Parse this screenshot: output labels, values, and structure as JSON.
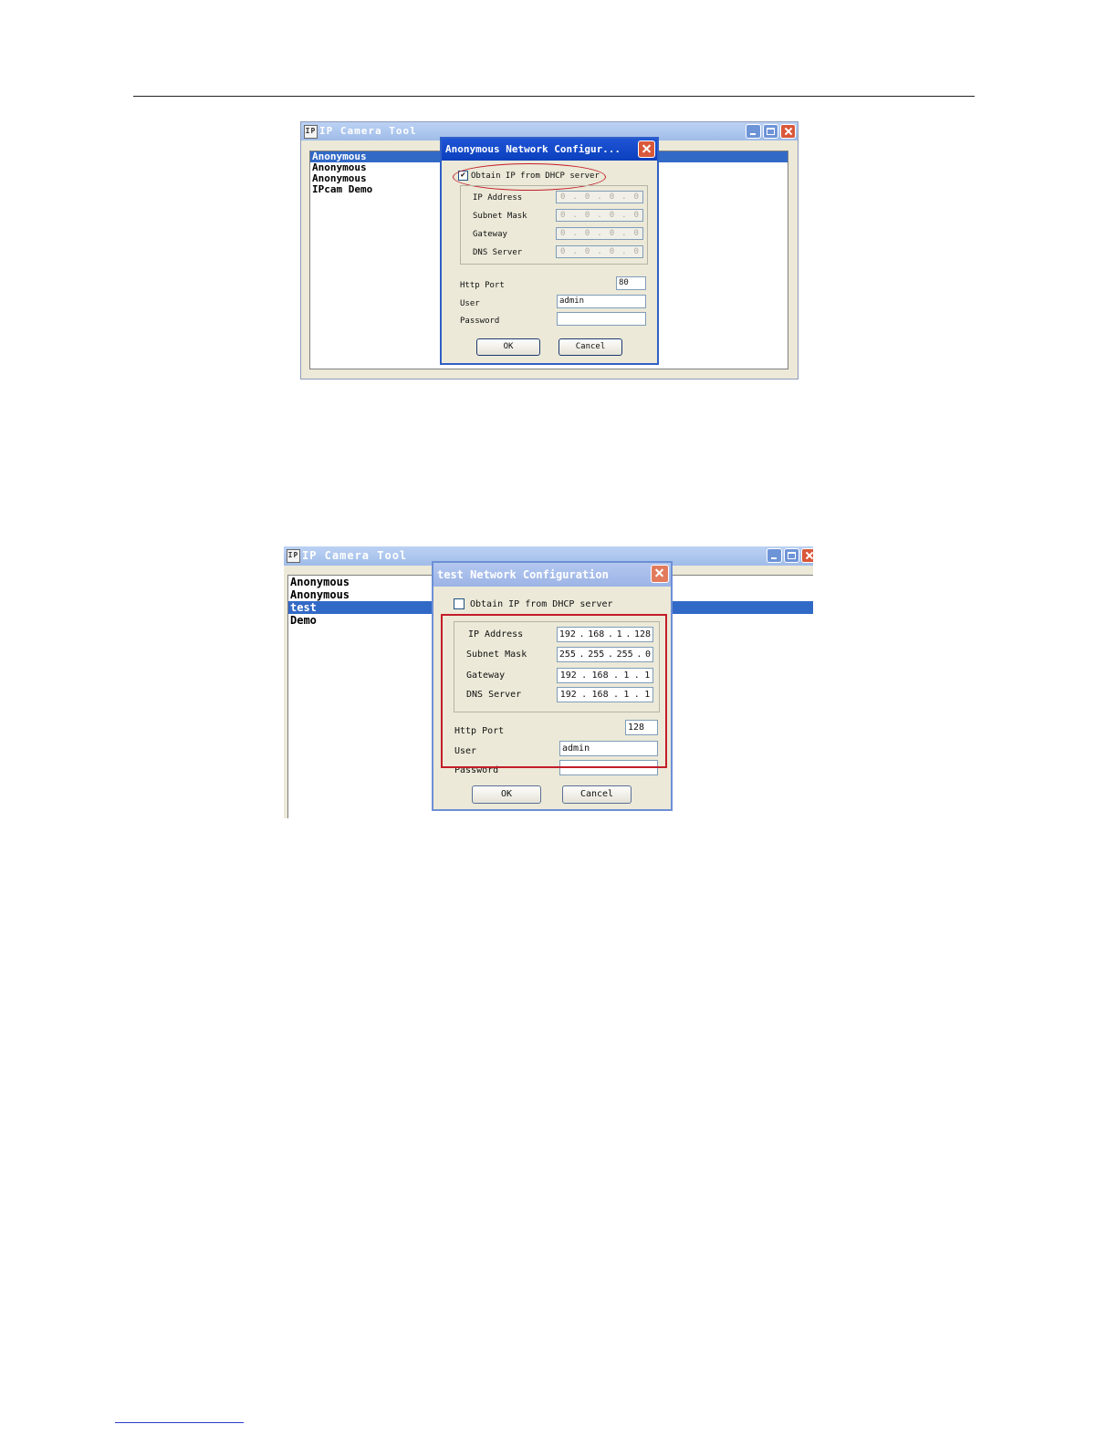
{
  "screenshots": [
    {
      "app": {
        "title": "IP Camera Tool",
        "icon_text": "IP",
        "cameras": [
          {
            "label": "Anonymous",
            "selected": true
          },
          {
            "label": "Anonymous",
            "selected": false
          },
          {
            "label": "Anonymous",
            "selected": false
          },
          {
            "label": "IPcam Demo",
            "selected": false
          }
        ]
      },
      "dialog": {
        "title": "Anonymous Network Configur...",
        "dhcp": {
          "label": "Obtain IP from DHCP server",
          "checked": true,
          "check_mark": "✔"
        },
        "network": [
          {
            "label": "IP Address",
            "octets": [
              "0",
              "0",
              "0",
              "0"
            ]
          },
          {
            "label": "Subnet Mask",
            "octets": [
              "0",
              "0",
              "0",
              "0"
            ]
          },
          {
            "label": "Gateway",
            "octets": [
              "0",
              "0",
              "0",
              "0"
            ]
          },
          {
            "label": "DNS Server",
            "octets": [
              "0",
              "0",
              "0",
              "0"
            ]
          }
        ],
        "http_port": {
          "label": "Http Port",
          "value": "80"
        },
        "user": {
          "label": "User",
          "value": "admin"
        },
        "password": {
          "label": "Password",
          "value": ""
        },
        "ok_label": "OK",
        "cancel_label": "Cancel"
      },
      "highlight": "ellipse around DHCP checkbox"
    },
    {
      "app": {
        "title": "IP Camera Tool",
        "icon_text": "IP",
        "cameras": [
          {
            "label": "Anonymous",
            "selected": false
          },
          {
            "label": "Anonymous",
            "selected": false
          },
          {
            "label": "test",
            "selected": true
          },
          {
            "label": "Demo",
            "selected": false
          }
        ]
      },
      "dialog": {
        "title": "test Network Configuration",
        "dhcp": {
          "label": "Obtain IP from DHCP server",
          "checked": false,
          "check_mark": ""
        },
        "network": [
          {
            "label": "IP Address",
            "octets": [
              "192",
              "168",
              "1",
              "128"
            ]
          },
          {
            "label": "Subnet Mask",
            "octets": [
              "255",
              "255",
              "255",
              "0"
            ]
          },
          {
            "label": "Gateway",
            "octets": [
              "192",
              "168",
              "1",
              "1"
            ]
          },
          {
            "label": "DNS Server",
            "octets": [
              "192",
              "168",
              "1",
              "1"
            ]
          }
        ],
        "http_port": {
          "label": "Http Port",
          "value": "128"
        },
        "user": {
          "label": "User",
          "value": "admin"
        },
        "password": {
          "label": "Password",
          "value": ""
        },
        "ok_label": "OK",
        "cancel_label": "Cancel"
      },
      "highlight": "rectangle around manual network fields"
    }
  ],
  "colors": {
    "selection": "#3169c6",
    "highlight_red": "#c21d2a",
    "dialog_bg": "#ece9d8"
  }
}
